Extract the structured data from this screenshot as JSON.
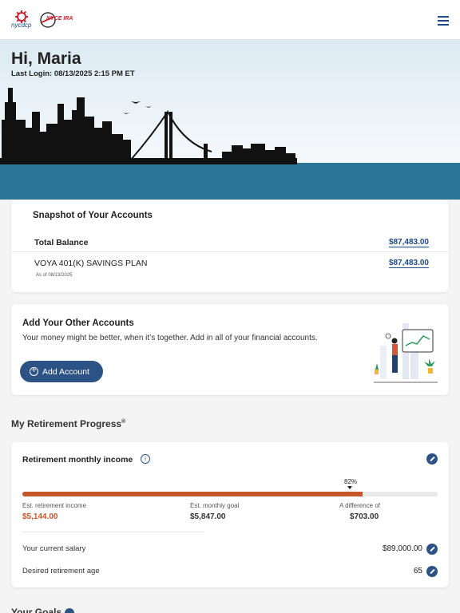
{
  "header": {
    "logo1_text": "nycdcp",
    "logo2_text": "NYCE IRA",
    "menu_icon": "hamburger-menu-icon"
  },
  "hero": {
    "greeting": "Hi, Maria",
    "last_login": "Last Login: 08/13/2025 2:15 PM ET"
  },
  "snapshot": {
    "title": "Snapshot of Your Accounts",
    "total_label": "Total Balance",
    "total_value": "$87,483.00",
    "accounts": [
      {
        "name": "VOYA 401(K) SAVINGS PLAN",
        "value": "$87,483.00",
        "as_of": "As of 08/13/2025"
      }
    ]
  },
  "add_accounts": {
    "title": "Add Your Other Accounts",
    "description": "Your money might be better, when it’s together. Add in all of your financial accounts.",
    "button_label": "Add Account"
  },
  "retirement": {
    "heading": "My Retirement Progress",
    "heading_mark": "®",
    "card_title": "Retirement monthly income",
    "progress_percent": 82,
    "progress_label": "82%",
    "est_income_label": "Est. retirement income",
    "est_income_value": "$5,144.00",
    "monthly_goal_label": "Est. monthly goal",
    "monthly_goal_value": "$5,847.00",
    "difference_label": "A difference of",
    "difference_value": "$703.00",
    "salary_label": "Your current salary",
    "salary_value": "$89,000.00",
    "age_label": "Desired retirement age",
    "age_value": "65"
  },
  "goals": {
    "heading": "Your Goals"
  },
  "colors": {
    "brand_blue": "#2c5286",
    "accent_orange": "#c4562a",
    "water": "#2b7596"
  }
}
